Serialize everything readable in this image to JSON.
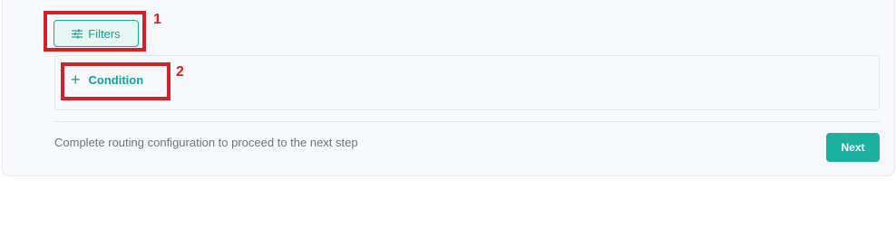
{
  "toolbar": {
    "filters_label": "Filters",
    "filters_icon": "sliders-icon"
  },
  "conditions": {
    "add_label": "Condition",
    "add_icon": "plus-icon"
  },
  "footer": {
    "helper_text": "Complete routing configuration to proceed to the next step",
    "next_label": "Next"
  },
  "annotations": [
    {
      "label": "1"
    },
    {
      "label": "2"
    }
  ],
  "colors": {
    "accent": "#1bb09f",
    "annotation": "#d5202a"
  }
}
